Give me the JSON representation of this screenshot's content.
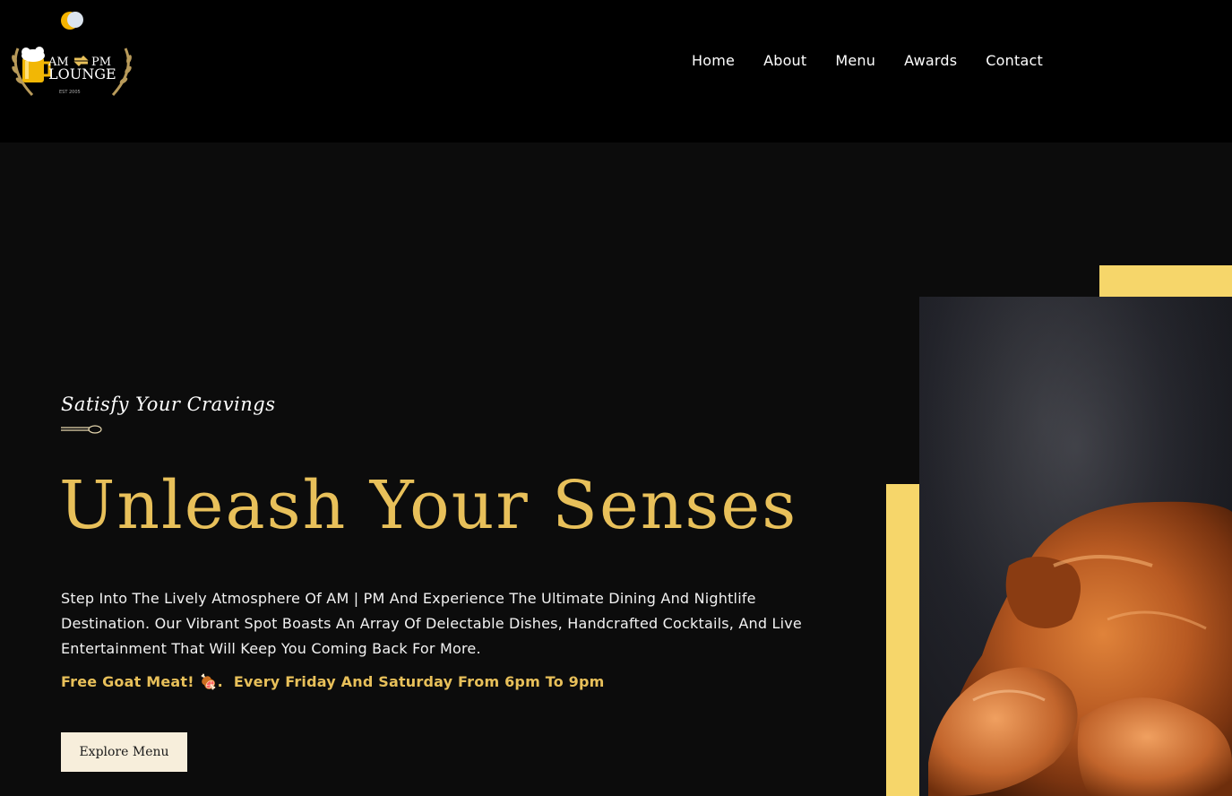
{
  "logo": {
    "alt": "AM PM Lounge logo",
    "line1_left": "AM",
    "line1_right": "PM",
    "line2": "LOUNGE",
    "est": "EST 2005",
    "icon": "sun-moon-icon"
  },
  "nav": {
    "items": [
      {
        "label": "Home"
      },
      {
        "label": "About"
      },
      {
        "label": "Menu"
      },
      {
        "label": "Awards"
      },
      {
        "label": "Contact"
      }
    ]
  },
  "hero": {
    "subtitle": "Satisfy Your Cravings",
    "headline": "Unleash Your Senses",
    "description": "Step Into The Lively Atmosphere Of AM | PM And Experience The Ultimate Dining And Nightlife Destination. Our Vibrant Spot Boasts An Array Of Delectable Dishes, Handcrafted Cocktails, And Live Entertainment That Will Keep You Coming Back For More.",
    "promo_part1": "Free Goat Meat! 🍖.",
    "promo_part2": "Every Friday And Saturday From 6pm To 9pm",
    "cta_label": "Explore Menu",
    "image_alt": "roasted chicken"
  },
  "colors": {
    "accent_gold": "#e8c05a",
    "accent_yellow": "#f6d66a",
    "header_bg": "#000000",
    "hero_bg": "#0c0c0c",
    "button_bg": "#f7eedb"
  }
}
